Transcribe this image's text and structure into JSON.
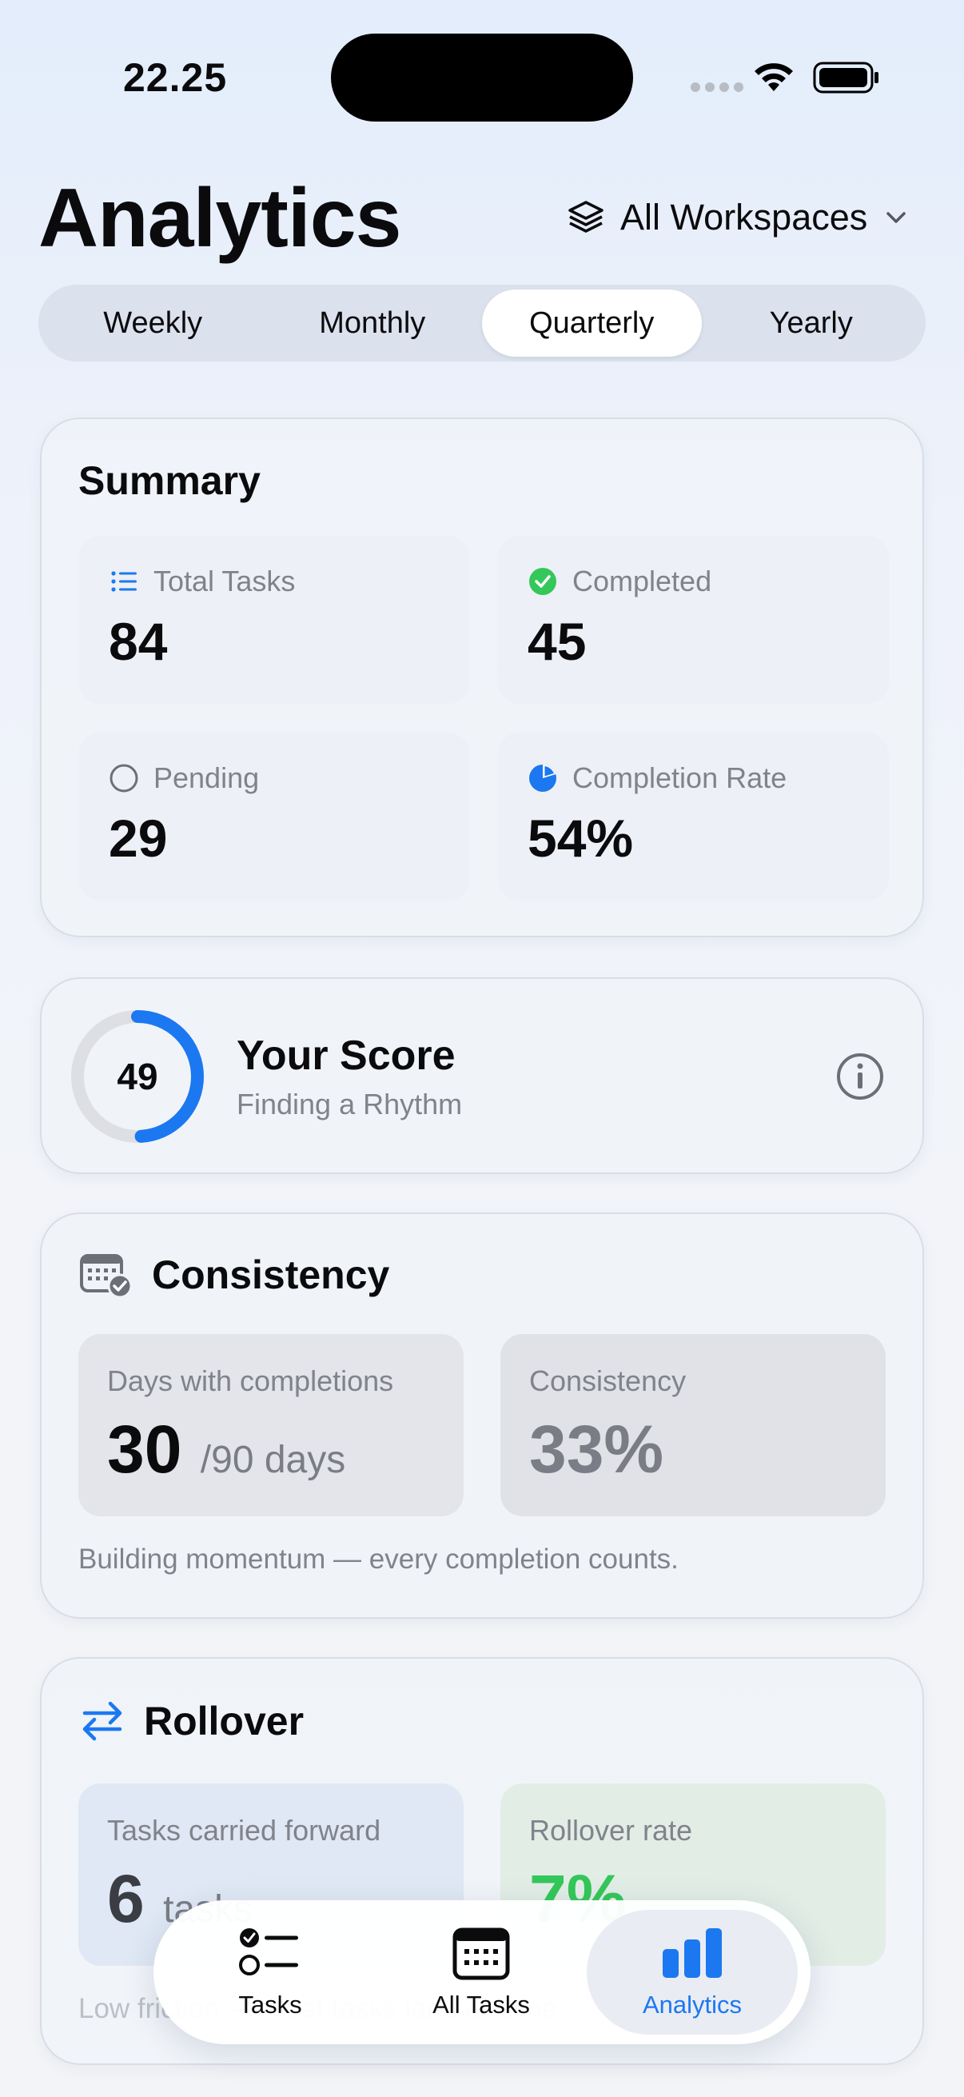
{
  "status_bar": {
    "time": "22.25"
  },
  "header": {
    "title": "Analytics",
    "workspace_label": "All Workspaces"
  },
  "period_tabs": [
    {
      "label": "Weekly",
      "selected": false
    },
    {
      "label": "Monthly",
      "selected": false
    },
    {
      "label": "Quarterly",
      "selected": true
    },
    {
      "label": "Yearly",
      "selected": false
    }
  ],
  "summary": {
    "title": "Summary",
    "total_tasks": {
      "label": "Total Tasks",
      "value": "84",
      "icon": "list-icon"
    },
    "completed": {
      "label": "Completed",
      "value": "45",
      "icon": "check-circle-icon"
    },
    "pending": {
      "label": "Pending",
      "value": "29",
      "icon": "empty-circle-icon"
    },
    "completion_rate": {
      "label": "Completion Rate",
      "value": "54%",
      "icon": "pie-icon",
      "fraction": 0.54
    }
  },
  "score": {
    "value": "49",
    "fraction": 0.49,
    "title": "Your Score",
    "subtitle": "Finding a Rhythm"
  },
  "consistency": {
    "title": "Consistency",
    "days_label": "Days with completions",
    "days_value": "30",
    "days_unit": "/90 days",
    "rate_label": "Consistency",
    "rate_value": "33%",
    "note": "Building momentum — every completion counts."
  },
  "rollover": {
    "title": "Rollover",
    "carried_label": "Tasks carried forward",
    "carried_value": "6",
    "carried_unit": "tasks",
    "rate_label": "Rollover rate",
    "rate_value": "7%",
    "note": "Low friction — most tasks land on time"
  },
  "tab_bar": {
    "tasks_label": "Tasks",
    "all_tasks_label": "All Tasks",
    "analytics_label": "Analytics",
    "active": "Analytics"
  },
  "colors": {
    "accent_blue": "#1c78f0",
    "green": "#34c759",
    "muted_text": "#80838b"
  }
}
